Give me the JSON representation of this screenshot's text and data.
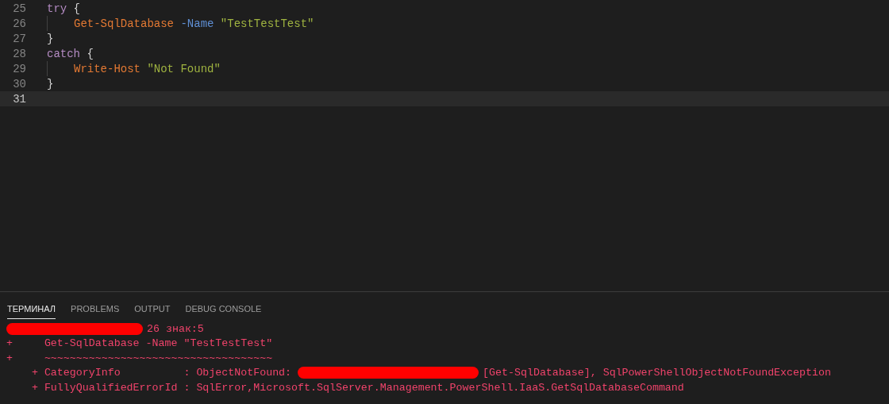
{
  "editor": {
    "lines": [
      {
        "number": "25",
        "current": false,
        "tokens": [
          {
            "kind": "keyword",
            "text": "try"
          },
          {
            "kind": "punct",
            "text": " {"
          }
        ],
        "children": [
          {
            "number": "26",
            "current": false,
            "tokens": [
              {
                "kind": "command",
                "text": "Get-SqlDatabase"
              },
              {
                "kind": "param",
                "text": " -Name"
              },
              {
                "kind": "string",
                "text": " \"TestTestTest\""
              }
            ]
          }
        ]
      },
      {
        "number": "27",
        "current": false,
        "tokens": [
          {
            "kind": "punct",
            "text": "}"
          }
        ]
      },
      {
        "number": "28",
        "current": false,
        "tokens": [
          {
            "kind": "keyword",
            "text": "catch"
          },
          {
            "kind": "punct",
            "text": " {"
          }
        ],
        "children": [
          {
            "number": "29",
            "current": false,
            "tokens": [
              {
                "kind": "command",
                "text": "Write-Host"
              },
              {
                "kind": "string",
                "text": " \"Not Found\""
              }
            ]
          }
        ]
      },
      {
        "number": "30",
        "current": false,
        "tokens": [
          {
            "kind": "punct",
            "text": "}"
          }
        ]
      },
      {
        "number": "31",
        "current": true
      }
    ]
  },
  "panel": {
    "tabs": [
      {
        "label": "ТЕРМИНАЛ",
        "selected": true
      },
      {
        "label": "PROBLEMS",
        "selected": false
      },
      {
        "label": "OUTPUT",
        "selected": false
      },
      {
        "label": "DEBUG CONSOLE",
        "selected": false
      }
    ],
    "terminal_lines": [
      [
        {
          "kind": "redaction"
        },
        {
          "kind": "text",
          "text": "26 знак:5"
        }
      ],
      [
        {
          "kind": "text",
          "text": "+     Get-SqlDatabase -Name \"TestTestTest\""
        }
      ],
      [
        {
          "kind": "text",
          "text": "+     ~~~~~~~~~~~~~~~~~~~~~~~~~~~~~~~~~~~~"
        }
      ],
      [
        {
          "kind": "text",
          "text": "    + CategoryInfo          : ObjectNotFound: "
        },
        {
          "kind": "redaction"
        },
        {
          "kind": "text",
          "text": "[Get-SqlDatabase], SqlPowerShellObjectNotFoundException"
        }
      ],
      [
        {
          "kind": "text",
          "text": "    + FullyQualifiedErrorId : SqlError,Microsoft.SqlServer.Management.PowerShell.IaaS.GetSqlDatabaseCommand"
        }
      ]
    ]
  }
}
